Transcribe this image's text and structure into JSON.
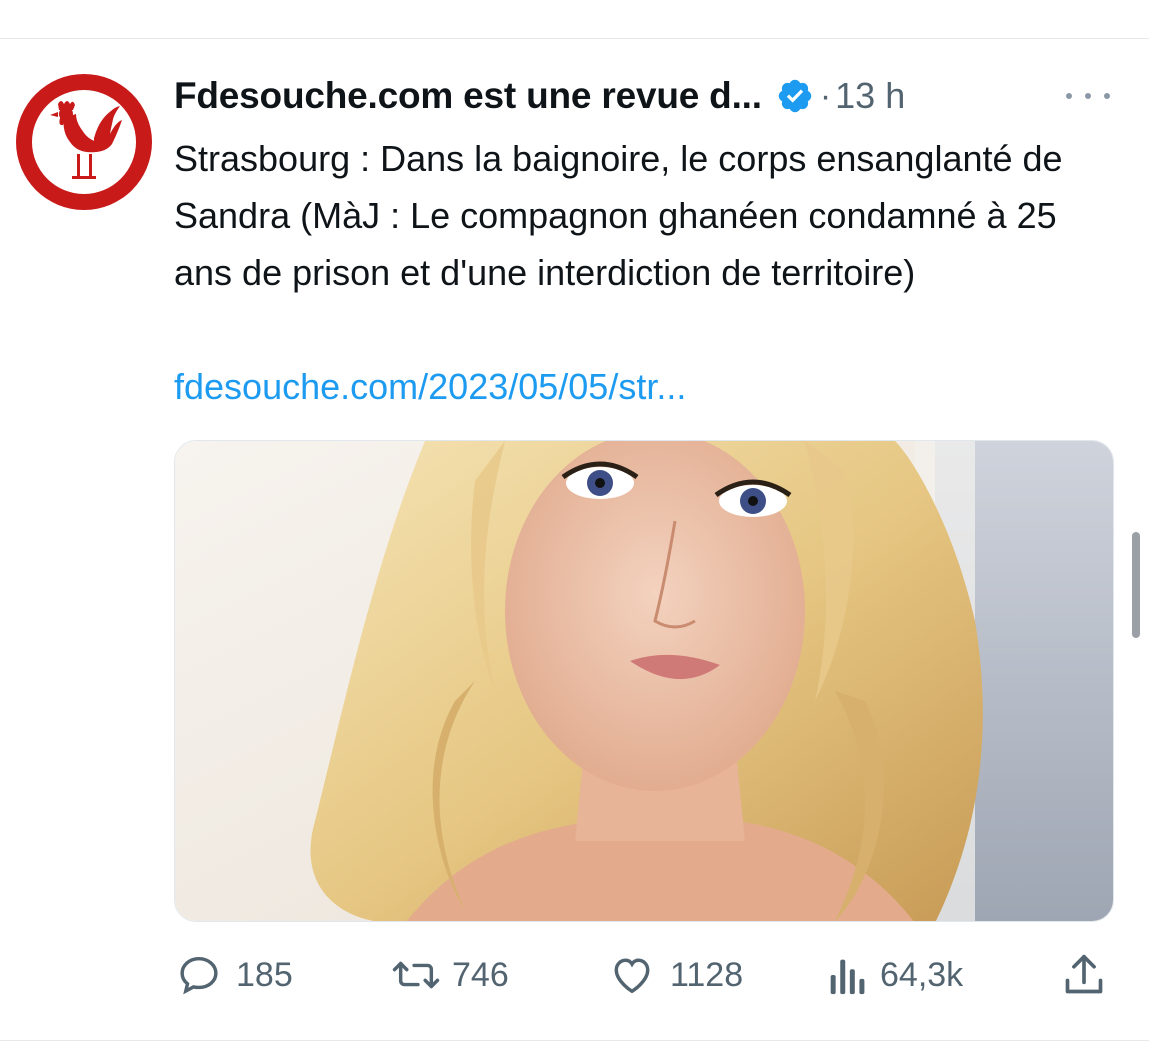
{
  "tweet": {
    "display_name": "Fdesouche.com est une revue d...",
    "verified": true,
    "separator": "·",
    "timestamp": "13 h",
    "text": "Strasbourg : Dans la baignoire, le corps ensanglanté de Sandra (MàJ : Le compagnon ghanéen condamné à 25 ans de prison et d'une interdiction de territoire)",
    "link": "fdesouche.com/2023/05/05/str...",
    "avatar_icon": "rooster-logo-icon",
    "media_alt": "photo-of-woman"
  },
  "actions": {
    "replies": "185",
    "retweets": "746",
    "likes": "1128",
    "views": "64,3k",
    "share_icon": "share-icon"
  },
  "colors": {
    "brand_red": "#c91a1a",
    "link_blue": "#1d9bf0",
    "verified_blue": "#1d9bf0",
    "muted_gray": "#536471",
    "text": "#0f1419"
  }
}
